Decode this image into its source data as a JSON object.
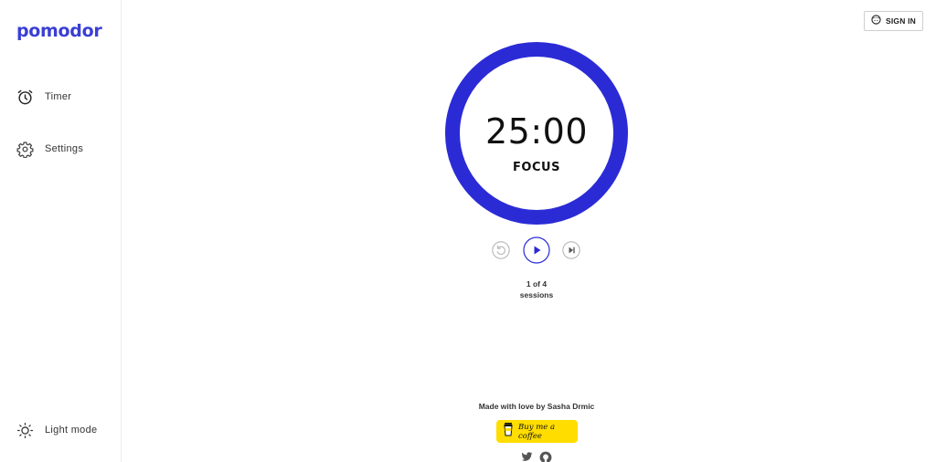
{
  "app": {
    "logo_text": "pomodor",
    "brand_color": "#2b2bd6"
  },
  "sidebar": {
    "items": [
      {
        "label": "Timer",
        "icon": "alarm-clock-icon"
      },
      {
        "label": "Settings",
        "icon": "gear-icon"
      }
    ],
    "theme_toggle": {
      "label": "Light mode",
      "icon": "sun-icon"
    }
  },
  "header": {
    "signin_label": "SIGN IN",
    "signin_icon": "user-face-icon"
  },
  "timer": {
    "time": "25:00",
    "mode": "FOCUS",
    "ring_color": "#2b2bd6",
    "progress": 1.0
  },
  "controls": {
    "reset_icon": "restart-icon",
    "play_icon": "play-icon",
    "skip_icon": "skip-next-icon"
  },
  "sessions": {
    "count": "1 of 4",
    "label": "sessions"
  },
  "footer": {
    "credit": "Made with love by Sasha Drmic",
    "coffee_label": "Buy me a coffee",
    "coffee_color": "#ffdd00",
    "social_icons": [
      "twitter-icon",
      "github-icon"
    ]
  }
}
